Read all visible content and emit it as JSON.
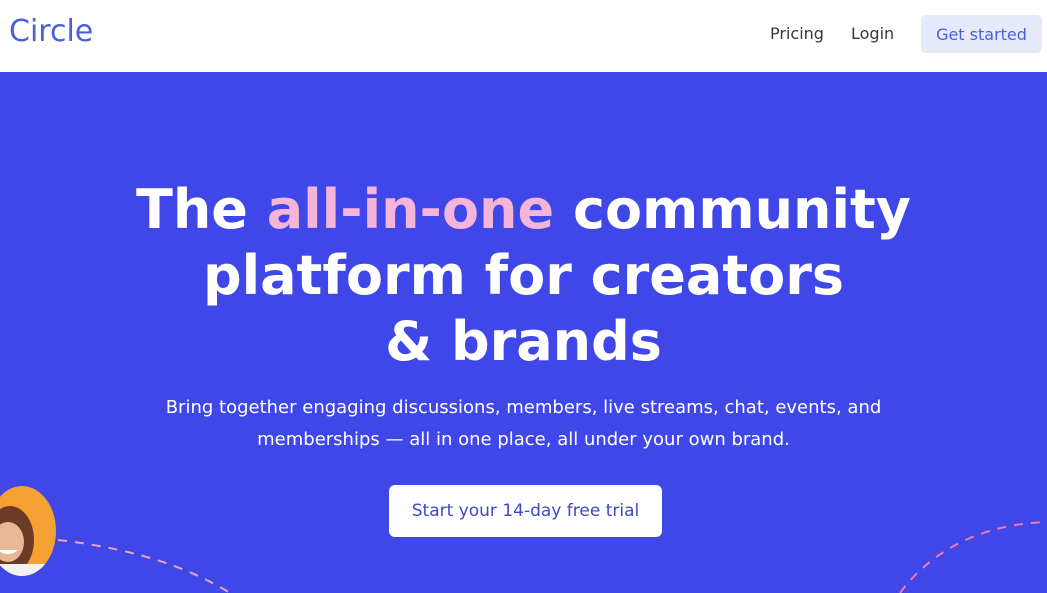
{
  "header": {
    "logo": "Circle",
    "nav": {
      "pricing": "Pricing",
      "login": "Login"
    },
    "cta": "Get started"
  },
  "hero": {
    "headline": {
      "prefix": "The",
      "accent": "all-in-one",
      "line1_suffix": "community",
      "line2": "platform for creators",
      "line3": "& brands"
    },
    "subhead": {
      "line1": "Bring together engaging discussions, members, live streams, chat, events, and",
      "line2": "memberships — all in one place, all under your own brand."
    },
    "cta": "Start your 14-day free trial"
  },
  "colors": {
    "brand": "#4a5fe0",
    "hero_bg": "#3f47e9",
    "accent_text": "#f5b4da",
    "deco_line_left": "#f0a0c0",
    "deco_line_right": "#f07ab0"
  }
}
